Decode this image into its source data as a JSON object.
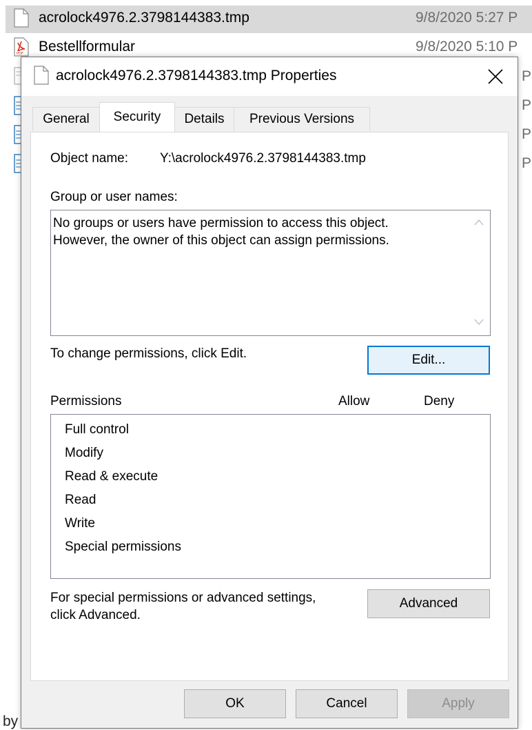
{
  "explorer": {
    "files": [
      {
        "name": "acrolock4976.2.3798144383.tmp",
        "date": "9/8/2020 5:27 P"
      },
      {
        "name": "Bestellformular",
        "date": "9/8/2020 5:10 P"
      }
    ],
    "edge_suffix": "P",
    "bottom_text": "by"
  },
  "dialog": {
    "title": "acrolock4976.2.3798144383.tmp Properties",
    "tabs": [
      "General",
      "Security",
      "Details",
      "Previous Versions"
    ],
    "active_tab": "Security",
    "object_name_label": "Object name:",
    "object_name_value": "Y:\\acrolock4976.2.3798144383.tmp",
    "group_label": "Group or user names:",
    "group_message_line1": "No groups or users have permission to access this object.",
    "group_message_line2": "However, the owner of this object can assign permissions.",
    "change_text": "To change permissions, click Edit.",
    "edit_button": "Edit...",
    "permissions_header": "Permissions",
    "allow_header": "Allow",
    "deny_header": "Deny",
    "permissions": [
      "Full control",
      "Modify",
      "Read & execute",
      "Read",
      "Write",
      "Special permissions"
    ],
    "special_text_line1": "For special permissions or advanced settings,",
    "special_text_line2": "click Advanced.",
    "advanced_button": "Advanced",
    "ok_button": "OK",
    "cancel_button": "Cancel",
    "apply_button": "Apply"
  },
  "colors": {
    "accent": "#0078d7",
    "selection": "#d9d9d9",
    "dialog_bg": "#f0f0f0"
  }
}
